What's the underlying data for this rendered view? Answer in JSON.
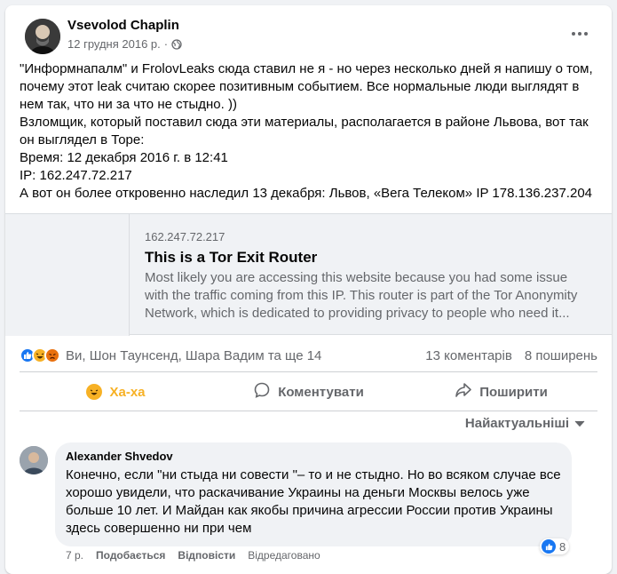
{
  "post": {
    "author": "Vsevolod Chaplin",
    "date": "12 грудня 2016 р.",
    "dot": "·",
    "text_lines": [
      "\"Информнапалм\" и FrolovLeaks сюда ставил не я - но через несколько дней я напишу о том, почему этот leak считаю скорее позитивным событием. Все нормальные люди выглядят в нем так, что ни за что не стыдно. ))",
      "Взломщик, который поставил сюда эти материалы, располагается в районе Львова, вот так он выглядел в Торе:",
      "Время: 12 декабря 2016 г. в 12:41",
      "IP: 162.247.72.217",
      "А вот он более откровенно наследил 13 декабря: Львов, «Вега Телеком» IP 178.136.237.204"
    ]
  },
  "link": {
    "domain": "162.247.72.217",
    "title": "This is a Tor Exit Router",
    "description": "Most likely you are accessing this website because you had some issue with the traffic coming from this IP. This router is part of the Tor Anonymity Network, which is dedicated to providing privacy to people who need it..."
  },
  "stats": {
    "reacters": "Ви, Шон Таунсенд, Шара Вадим та ще 14",
    "comments": "13 коментарів",
    "shares": "8 поширень"
  },
  "actions": {
    "reaction": "Ха-ха",
    "comment": "Коментувати",
    "share": "Поширити"
  },
  "sort": {
    "label": "Найактуальніші"
  },
  "comment": {
    "name": "Alexander Shvedov",
    "text": "Конечно, если \"ни стыда ни совести \"– то и не стыдно. Но во всяком случае все хорошо увидели, что раскачивание Украины на деньги Москвы велось уже больше 10 лет. И Майдан как якобы причина агрессии России против Украины здесь совершенно ни при чем",
    "reaction_count": "8",
    "time": "7 р.",
    "like": "Подобається",
    "reply": "Відповісти",
    "edited": "Відредаговано"
  },
  "colors": {
    "accent": "#1877f2",
    "haha": "#f7b125",
    "muted": "#65676b"
  }
}
